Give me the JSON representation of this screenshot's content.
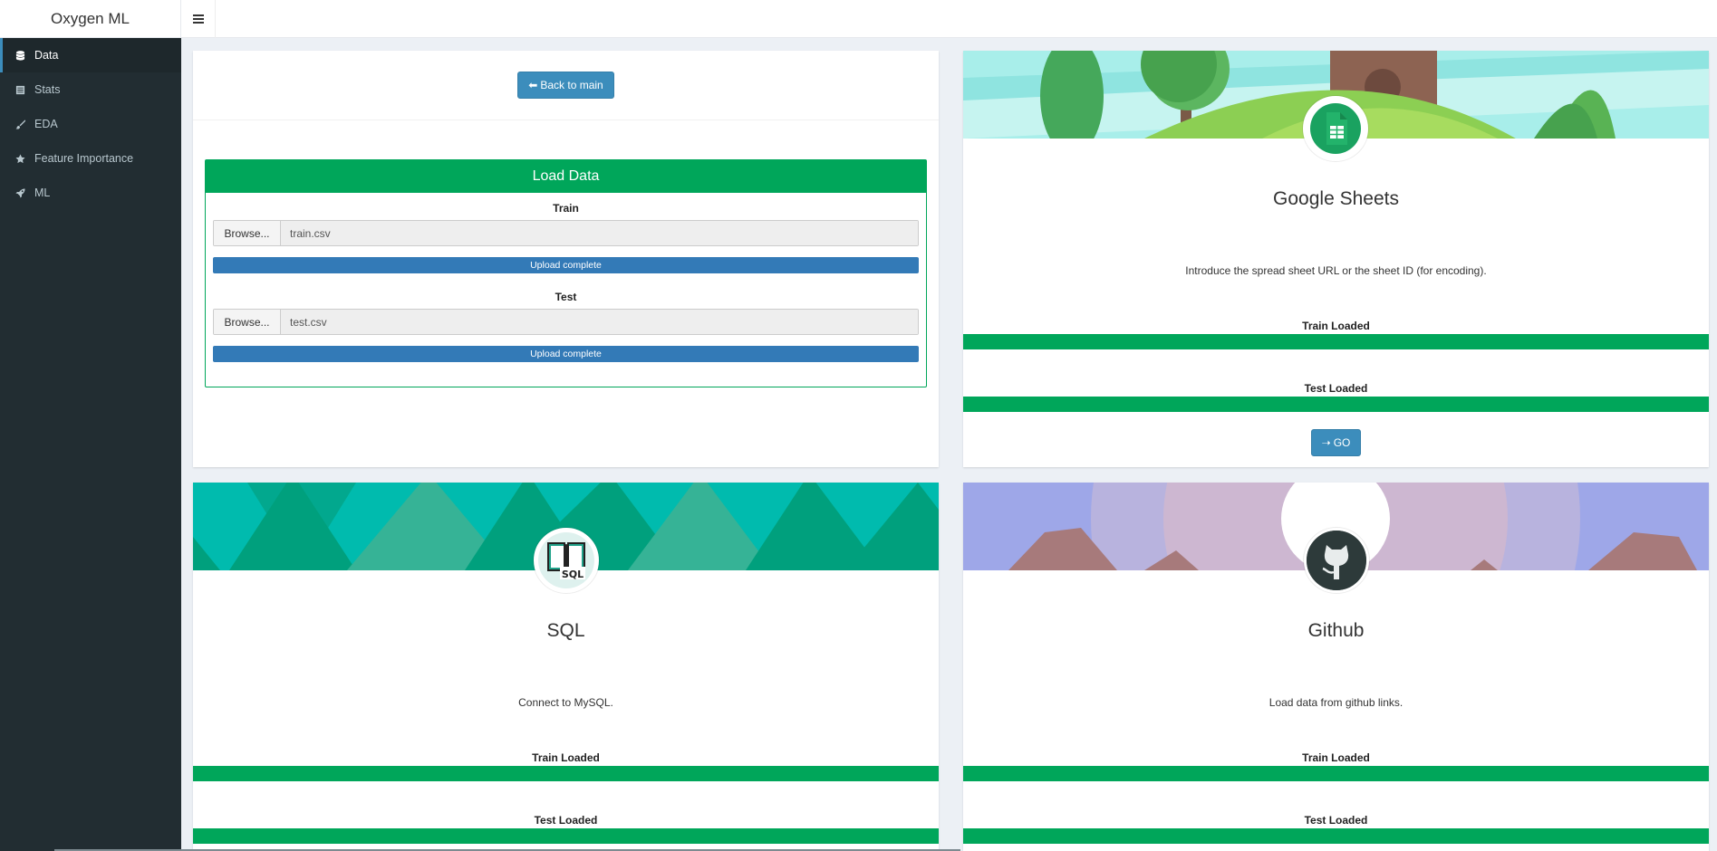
{
  "app": {
    "title": "Oxygen ML"
  },
  "sidebar": {
    "items": [
      {
        "label": "Data",
        "icon": "database-icon",
        "active": true
      },
      {
        "label": "Stats",
        "icon": "table-icon"
      },
      {
        "label": "EDA",
        "icon": "paint-brush-icon"
      },
      {
        "label": "Feature Importance",
        "icon": "star-icon"
      },
      {
        "label": "ML",
        "icon": "rocket-icon"
      }
    ]
  },
  "load_panel": {
    "back_label": "Back to main",
    "title": "Load Data",
    "train": {
      "label": "Train",
      "browse_label": "Browse...",
      "file": "train.csv",
      "progress_text": "Upload complete",
      "progress": 1.0
    },
    "test": {
      "label": "Test",
      "browse_label": "Browse...",
      "file": "test.csv",
      "progress_text": "Upload complete",
      "progress": 1.0
    }
  },
  "google_sheets": {
    "title": "Google Sheets",
    "description": "Introduce the spread sheet URL or the sheet ID (for encoding).",
    "train_label": "Train Loaded",
    "test_label": "Test Loaded",
    "go_label": "GO"
  },
  "sql": {
    "title": "SQL",
    "description": "Connect to MySQL.",
    "train_label": "Train Loaded",
    "test_label": "Test Loaded",
    "icon_text": "SQL"
  },
  "github": {
    "title": "Github",
    "description": "Load data from github links.",
    "train_label": "Train Loaded",
    "test_label": "Test Loaded"
  },
  "colors": {
    "accent": "#3c8dbc",
    "success": "#00a65a",
    "sidebar_bg": "#222d32",
    "progress_blue": "#337ab7"
  }
}
